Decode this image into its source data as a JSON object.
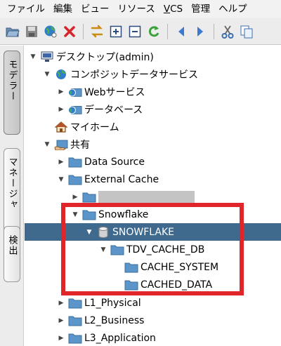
{
  "menu": {
    "items": [
      "ファイル",
      "編集",
      "ビュー",
      "リソース",
      "VCS",
      "管理",
      "ヘルプ"
    ]
  },
  "toolbar": {
    "buttons": [
      "open-folder-icon",
      "save-icon",
      "globe-icon",
      "delete-icon",
      "swap-icon",
      "expand-icon",
      "collapse-icon",
      "refresh-icon",
      "back-icon",
      "forward-icon",
      "cut-icon",
      "copy-icon"
    ]
  },
  "sidebar": {
    "tabs": [
      "モデラー",
      "マネージャ",
      "検出"
    ]
  },
  "tree": {
    "desktop": "デスクトップ(admin)",
    "composite": "コンポジットデータサービス",
    "web": "Webサービス",
    "database": "データベース",
    "myhome": "マイホーム",
    "shared": "共有",
    "datasource": "Data Source",
    "extcache": "External Cache",
    "redacted": "",
    "snowflake_folder": "Snowflake",
    "snowflake_db": "SNOWFLAKE",
    "tdv_cache_db": "TDV_CACHE_DB",
    "cache_system": "CACHE_SYSTEM",
    "cached_data": "CACHED_DATA",
    "l1": "L1_Physical",
    "l2": "L2_Business",
    "l3": "L3_Application"
  },
  "colors": {
    "selection": "#3f6a8e",
    "highlight": "#e0262b",
    "folder": "#5b95c9"
  }
}
